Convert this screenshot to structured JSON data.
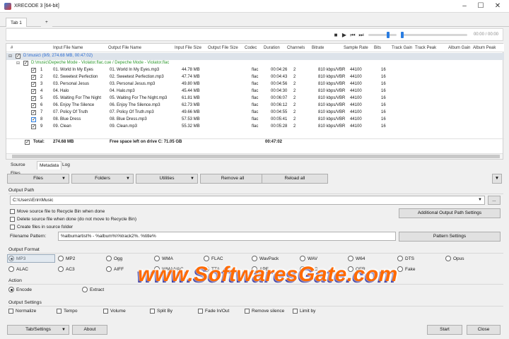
{
  "window": {
    "title": "XRECODE 3 [64-bit]"
  },
  "tabs": [
    {
      "label": "Tab 1"
    },
    {
      "label": "+"
    }
  ],
  "player": {
    "time": "00:00 / 00:00"
  },
  "table": {
    "columns": [
      "#",
      "Input File Name",
      "Output File Name",
      "Input File Size",
      "Output File Size",
      "Codec",
      "Duration",
      "Channels",
      "Bitrate",
      "Sample Rate",
      "Bits",
      "Track Gain",
      "Track Peak",
      "Album Gain",
      "Album Peak"
    ],
    "group1": "D:\\music\\ (9/9, 274.68 MB, 00:47:02)",
    "group2": "D:\\music\\Depeche Mode - Violator.flac.cue / Depeche Mode - Violator.flac",
    "rows": [
      {
        "n": "1",
        "in": "01. World In My Eyes",
        "out": "01. World In My Eyes.mp3",
        "size": "44.78 MB",
        "codec": "flac",
        "dur": "00:04:26",
        "ch": "2",
        "br": "810 kbps/VBR",
        "sr": "44100",
        "bits": "16"
      },
      {
        "n": "2",
        "in": "02. Sweetest Perfection",
        "out": "02. Sweetest Perfection.mp3",
        "size": "47.74 MB",
        "codec": "flac",
        "dur": "00:04:43",
        "ch": "2",
        "br": "810 kbps/VBR",
        "sr": "44100",
        "bits": "16"
      },
      {
        "n": "3",
        "in": "03. Personal Jesus",
        "out": "03. Personal Jesus.mp3",
        "size": "49.80 MB",
        "codec": "flac",
        "dur": "00:04:56",
        "ch": "2",
        "br": "810 kbps/VBR",
        "sr": "44100",
        "bits": "16"
      },
      {
        "n": "4",
        "in": "04. Halo",
        "out": "04. Halo.mp3",
        "size": "45.44 MB",
        "codec": "flac",
        "dur": "00:04:30",
        "ch": "2",
        "br": "810 kbps/VBR",
        "sr": "44100",
        "bits": "16"
      },
      {
        "n": "5",
        "in": "05. Waiting For The Night",
        "out": "05. Waiting For The Night.mp3",
        "size": "61.81 MB",
        "codec": "flac",
        "dur": "00:06:07",
        "ch": "2",
        "br": "810 kbps/VBR",
        "sr": "44100",
        "bits": "16"
      },
      {
        "n": "6",
        "in": "06. Enjoy The Silence",
        "out": "06. Enjoy The Silence.mp3",
        "size": "62.73 MB",
        "codec": "flac",
        "dur": "00:06:12",
        "ch": "2",
        "br": "810 kbps/VBR",
        "sr": "44100",
        "bits": "16"
      },
      {
        "n": "7",
        "in": "07. Policy Of Truth",
        "out": "07. Policy Of Truth.mp3",
        "size": "49.66 MB",
        "codec": "flac",
        "dur": "00:04:55",
        "ch": "2",
        "br": "810 kbps/VBR",
        "sr": "44100",
        "bits": "16"
      },
      {
        "n": "8",
        "in": "08. Blue Dress",
        "out": "08. Blue Dress.mp3",
        "size": "57.53 MB",
        "codec": "flac",
        "dur": "00:05:41",
        "ch": "2",
        "br": "810 kbps/VBR",
        "sr": "44100",
        "bits": "16"
      },
      {
        "n": "9",
        "in": "09. Clean",
        "out": "09. Clean.mp3",
        "size": "55.32 MB",
        "codec": "flac",
        "dur": "00:05:28",
        "ch": "2",
        "br": "810 kbps/VBR",
        "sr": "44100",
        "bits": "16"
      }
    ],
    "total_label": "Total:",
    "total_size": "274.68 MB",
    "free_space": "Free space left on drive C: 71.05 GB",
    "total_dur": "00:47:02"
  },
  "subtabs": [
    "Source Files",
    "Metadata",
    "Log"
  ],
  "toolbar": {
    "files": "Files",
    "folders": "Folders",
    "utilities": "Utilities",
    "remove_all": "Remove all",
    "reload_all": "Reload all"
  },
  "output_path": {
    "section": "Output Path",
    "value": "C:\\Users\\Erin\\Music",
    "browse": "...",
    "opt1": "Move source file to Recycle Bin when done",
    "opt2": "Delete source file when done (do not move to Recycle Bin)",
    "opt3": "Create files in source folder",
    "additional": "Additional Output Path Settings",
    "pattern_label": "Filename Pattern:",
    "pattern": "%albumartist% - %album%\\%track2%. %title%",
    "pattern_btn": "Pattern Settings"
  },
  "output_format": {
    "section": "Output Format",
    "row1": [
      "MP3",
      "MP2",
      "Ogg",
      "WMA",
      "FLAC",
      "WavPack",
      "WAV",
      "W64",
      "DTS",
      "Opus"
    ],
    "row2": [
      "ALAC",
      "AC3",
      "AIFF",
      "WMA/VAC",
      "TTA",
      "APE",
      "MPC",
      "OFR",
      "Fake"
    ]
  },
  "action": {
    "section": "Action",
    "encode": "Encode",
    "extract": "Extract"
  },
  "output_settings": {
    "section": "Output Settings",
    "items": [
      "Normalize",
      "Tempo",
      "Volume",
      "Split By",
      "Fade In/Out",
      "Remove silence",
      "Limit by"
    ]
  },
  "footer": {
    "tab_settings": "Tab/Settings",
    "about": "About",
    "start": "Start",
    "close": "Close"
  },
  "watermark": "www.SoftwaresGate.com"
}
